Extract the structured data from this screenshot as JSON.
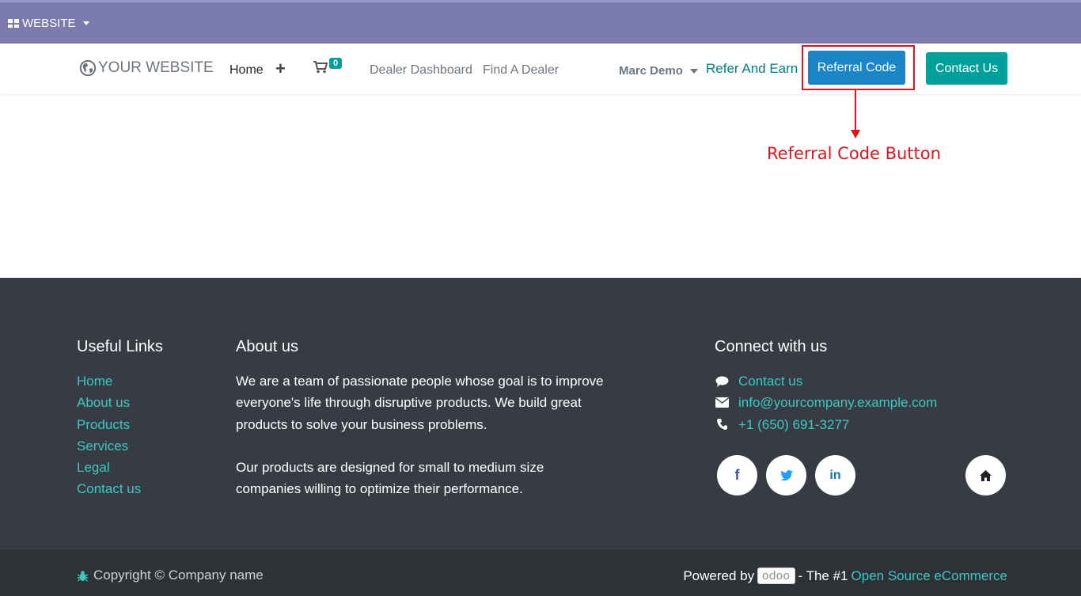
{
  "admin_bar": {
    "label": "WEBSITE"
  },
  "navbar": {
    "logo_text": "YOUR WEBSITE",
    "home": "Home",
    "plus": "+",
    "cart_count": "0",
    "dealer_dashboard": "Dealer Dashboard",
    "find_dealer": "Find A Dealer",
    "user": "Marc Demo",
    "refer_earn": "Refer And Earn",
    "referral_code": "Referral Code",
    "contact_us": "Contact Us"
  },
  "annotation": {
    "label": "Referral Code Button",
    "color": "#e0141e"
  },
  "footer": {
    "useful_links": {
      "title": "Useful Links",
      "items": [
        "Home",
        "About us",
        "Products",
        "Services",
        "Legal",
        "Contact us"
      ]
    },
    "about": {
      "title": "About us",
      "p1_l1": "We are a team of passionate people whose goal is to improve",
      "p1_l2": "everyone's life through disruptive products. We build great",
      "p1_l3": "products to solve your business problems.",
      "p2_l1": "Our products are designed for small to medium size",
      "p2_l2": "companies willing to optimize their performance."
    },
    "connect": {
      "title": "Connect with us",
      "contact": "Contact us",
      "email": "info@yourcompany.example.com",
      "phone": "+1 (650) 691-3277"
    },
    "social": {
      "facebook": "f",
      "twitter_icon": "twitter-bird",
      "linkedin": "in",
      "home_icon": "home"
    },
    "copyright": "Copyright © Company name",
    "powered_by": "Powered by",
    "odoo": "odoo",
    "the_1": "- The #1",
    "open_source": "Open Source eCommerce"
  },
  "colors": {
    "admin_bar": "#7c7bad",
    "teal": "#00a09d",
    "link": "#3ec7c2",
    "referral_button": "#1a86c8",
    "footer": "#373c44"
  }
}
